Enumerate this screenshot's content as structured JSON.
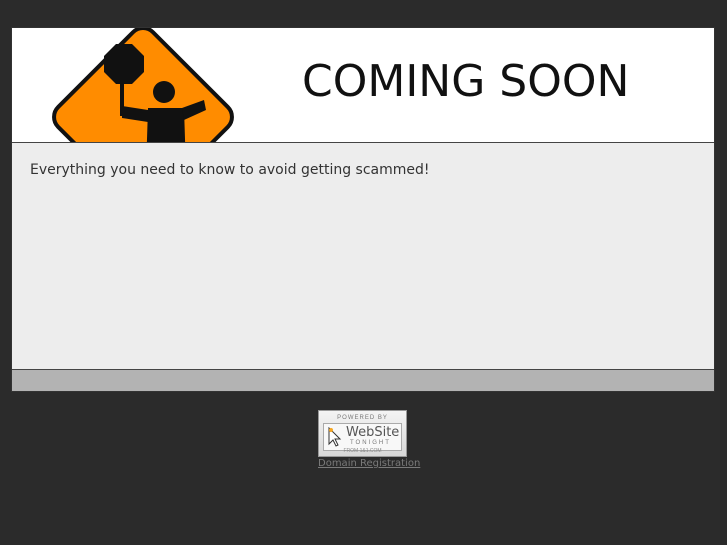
{
  "header": {
    "headline": "COMING SOON",
    "sign_icon": "construction-flagger-icon"
  },
  "content": {
    "text": "Everything you need to know to avoid getting scammed!"
  },
  "badge": {
    "powered_by": "POWERED BY",
    "brand": "WebSite",
    "tagline": "TONIGHT",
    "domain": "FROM 1&1.COM",
    "icon": "cursor-icon"
  },
  "footer": {
    "link_text": "Domain Registration"
  },
  "colors": {
    "background": "#2b2b2b",
    "sign_orange": "#ff8c00",
    "content_bg": "#ededed",
    "footer_bar": "#b3b3b3"
  }
}
